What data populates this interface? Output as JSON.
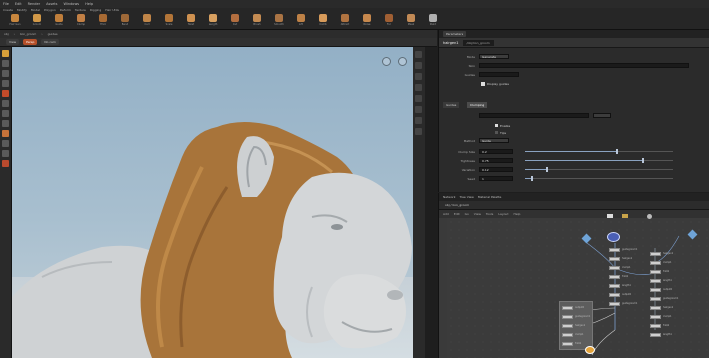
{
  "menubar": {
    "items": [
      "File",
      "Edit",
      "Render",
      "Assets",
      "Windows",
      "Help"
    ]
  },
  "shelf": {
    "tabs": [
      "Create",
      "Modify",
      "Model",
      "Polygon",
      "Deform",
      "Texture",
      "Rigging",
      "Hair Utils"
    ],
    "tools": [
      {
        "label": "Hair Gen",
        "color": "#c9873e"
      },
      {
        "label": "Groom",
        "color": "#d29948"
      },
      {
        "label": "Guide",
        "color": "#bf7e3b"
      },
      {
        "label": "Clump",
        "color": "#c17f44"
      },
      {
        "label": "Frizz",
        "color": "#a86a33"
      },
      {
        "label": "Bend",
        "color": "#9f6938"
      },
      {
        "label": "Curl",
        "color": "#c08548"
      },
      {
        "label": "Scale",
        "color": "#b37538"
      },
      {
        "label": "Twist",
        "color": "#cf9150"
      },
      {
        "label": "Length",
        "color": "#d8a060"
      },
      {
        "label": "Cut",
        "color": "#b36e3f"
      },
      {
        "label": "Brush",
        "color": "#c48b52"
      },
      {
        "label": "Smooth",
        "color": "#aa7444"
      },
      {
        "label": "Lift",
        "color": "#be8146"
      },
      {
        "label": "Comb",
        "color": "#d79b5a"
      },
      {
        "label": "Attract",
        "color": "#b07340"
      },
      {
        "label": "Noise",
        "color": "#c6884d"
      },
      {
        "label": "Fur",
        "color": "#a05f33"
      },
      {
        "label": "Mask",
        "color": "#c28a55"
      },
      {
        "label": "Paint",
        "color": "#b0b0b0"
      }
    ]
  },
  "pathbar": {
    "items": [
      "obj",
      "lion_groom",
      "guides"
    ]
  },
  "viewbar": {
    "pills": [
      "View",
      "Persp",
      "No cam"
    ],
    "active": "Persp"
  },
  "param_pane": {
    "tab": "Parameters",
    "node_name": "hairgen1",
    "node_path": "/obj/lion_groom",
    "rows": [
      {
        "label": "Mode",
        "value": "Generate"
      },
      {
        "label": "Skin",
        "value": ""
      },
      {
        "label": "Guides",
        "value": ""
      }
    ],
    "checkbox_label": "Display guides",
    "sections": [
      "Guides",
      "Clumping"
    ],
    "active_section": "Clumping",
    "clump_rows": [
      {
        "label": "Clump Size",
        "value": "0.2",
        "fill": 0.62
      },
      {
        "label": "Tightness",
        "value": "0.75",
        "fill": 0.8
      },
      {
        "label": "Variation",
        "value": "0.12",
        "fill": 0.15
      },
      {
        "label": "Seed",
        "value": "1",
        "fill": 0.05
      }
    ],
    "toggles": [
      "Enable",
      "Tips"
    ],
    "method_label": "Method",
    "method_value": "Guide"
  },
  "network_pane": {
    "tabs": [
      "Network",
      "Tree View",
      "Material Palette"
    ],
    "path": "obj / lion_groom",
    "menu": [
      "Add",
      "Edit",
      "Go",
      "View",
      "Tools",
      "Layout",
      "Help"
    ],
    "nodes": [
      "guidegroom1",
      "hairgen1",
      "clump1",
      "frizz1",
      "length1",
      "output0"
    ]
  }
}
